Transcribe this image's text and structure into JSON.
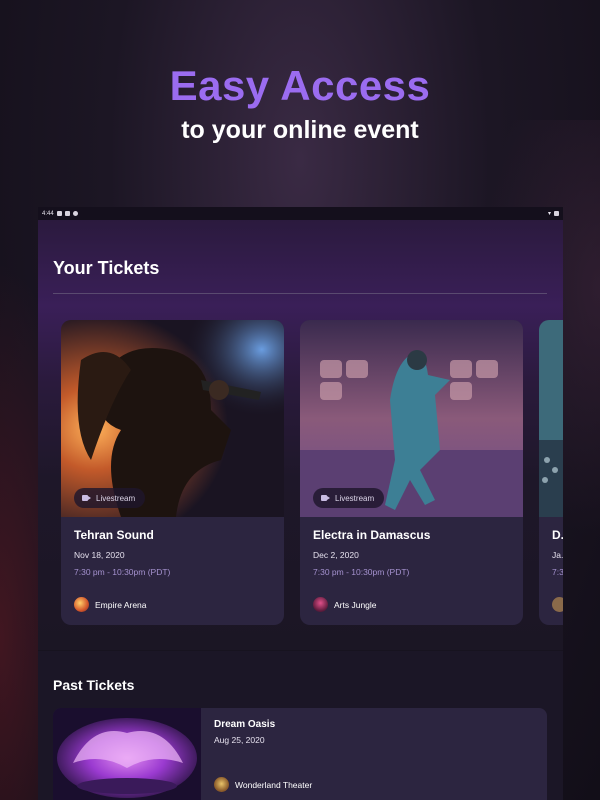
{
  "headline": {
    "title": "Easy Access",
    "subtitle": "to your online event"
  },
  "statusbar": {
    "time": "4:44"
  },
  "your_tickets": {
    "title": "Your Tickets",
    "cards": [
      {
        "title": "Tehran Sound",
        "date": "Nov 18, 2020",
        "time": "7:30 pm - 10:30pm (PDT)",
        "badge": "Livestream",
        "venue": "Empire Arena"
      },
      {
        "title": "Electra in Damascus",
        "date": "Dec 2, 2020",
        "time": "7:30 pm - 10:30pm (PDT)",
        "badge": "Livestream",
        "venue": "Arts Jungle"
      },
      {
        "title": "D...",
        "date": "Ja...",
        "time": "7:3...",
        "badge": "",
        "venue": ""
      }
    ]
  },
  "past_tickets": {
    "title": "Past Tickets",
    "cards": [
      {
        "title": "Dream Oasis",
        "date": "Aug 25, 2020",
        "venue": "Wonderland Theater"
      }
    ]
  }
}
